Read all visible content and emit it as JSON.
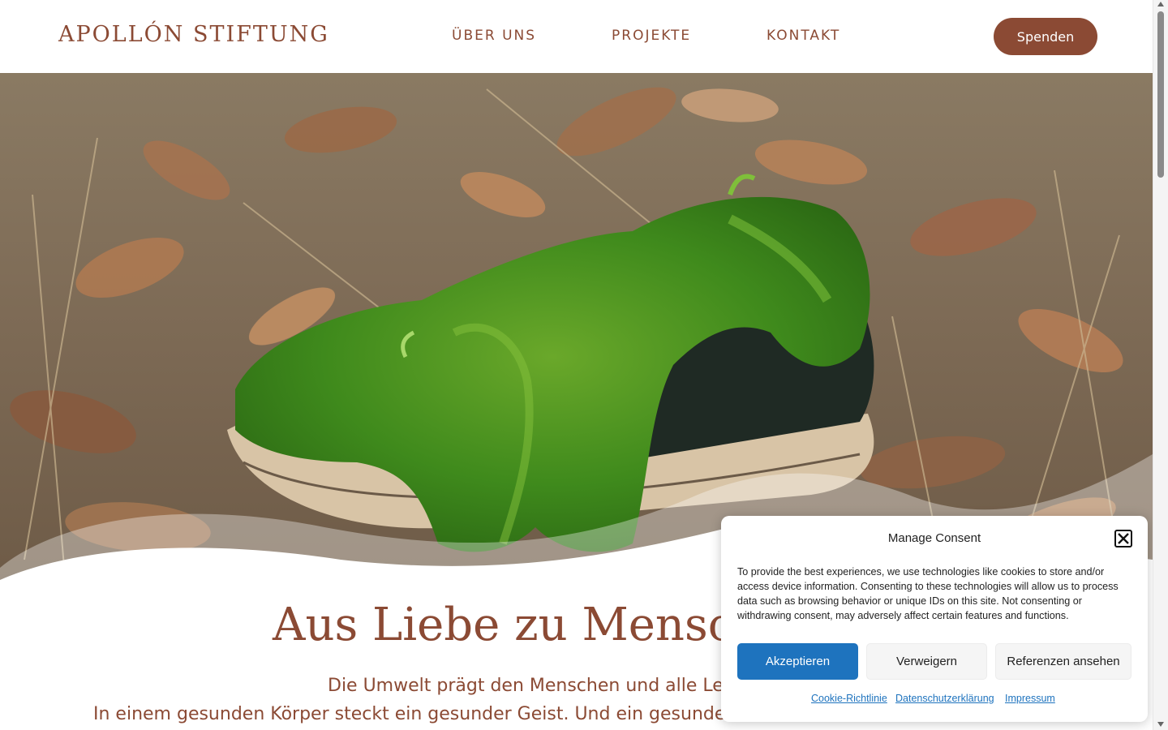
{
  "header": {
    "logo": "APOLLÓN STIFTUNG",
    "nav": [
      "ÜBER UNS",
      "PROJEKTE",
      "KONTAKT"
    ],
    "donate_label": "Spenden"
  },
  "hero": {
    "image_alt": "Moosbewachsener Schuh im Herbstlaub"
  },
  "content": {
    "headline": "Aus Liebe zu Mensch",
    "intro_line1": "Die Umwelt prägt den Menschen und alle Leb",
    "intro_line2": "In einem gesunden Körper steckt ein gesunder Geist. Und ein gesunder"
  },
  "consent": {
    "title": "Manage Consent",
    "text": "To provide the best experiences, we use technologies like cookies to store and/or access device information. Consenting to these technologies will allow us to process data such as browsing behavior or unique IDs on this site. Not consenting or withdrawing consent, may adversely affect certain features and functions.",
    "accept_label": "Akzeptieren",
    "deny_label": "Verweigern",
    "preferences_label": "Referenzen ansehen",
    "links": [
      "Cookie-Richtlinie",
      "Datenschutzerklärung",
      "Impressum"
    ]
  },
  "colors": {
    "brand": "#8b4a34",
    "accept": "#1e73be",
    "link": "#1e73be"
  }
}
